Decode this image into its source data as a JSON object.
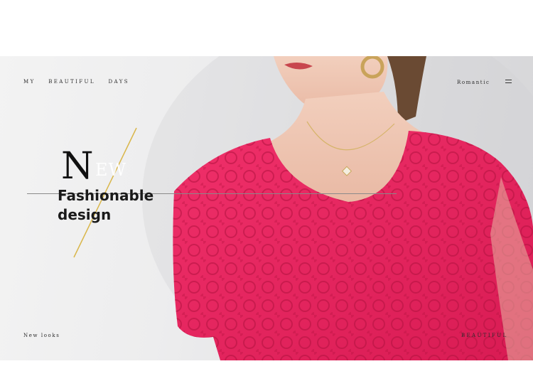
{
  "header": {
    "left_items": [
      "MY",
      "BEAUTIFUL",
      "DAYS"
    ],
    "right_label": "Romantic"
  },
  "hero": {
    "headline_initial": "N",
    "headline_rest": "EW",
    "tagline_line1": "Fashionable",
    "tagline_line2": "design"
  },
  "footer": {
    "left_label": "New looks",
    "right_label": "BEAUTIFUL"
  },
  "colors": {
    "dress": "#e8235f",
    "accent_line": "#d9b64a",
    "text_dark": "#1a1a1a"
  },
  "icons": {
    "menu": "hamburger-menu-icon"
  }
}
